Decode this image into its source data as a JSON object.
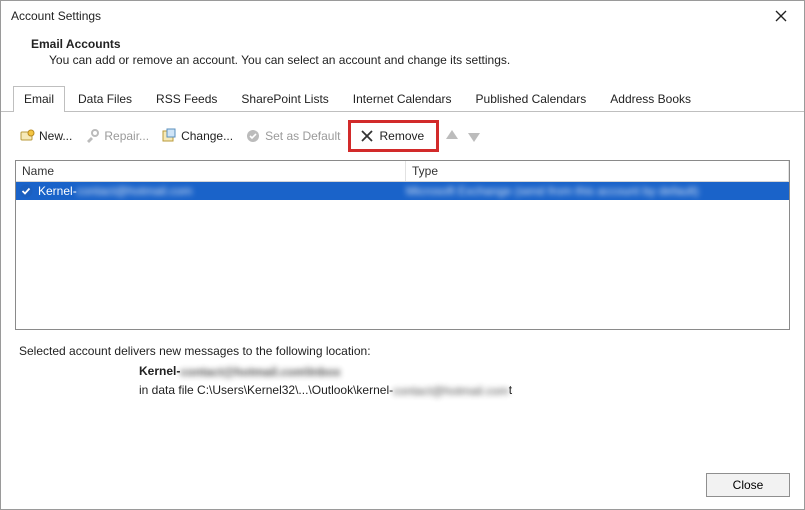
{
  "window_title": "Account Settings",
  "section": {
    "title": "Email Accounts",
    "text": "You can add or remove an account. You can select an account and change its settings."
  },
  "tabs": [
    {
      "label": "Email",
      "active": true
    },
    {
      "label": "Data Files"
    },
    {
      "label": "RSS Feeds"
    },
    {
      "label": "SharePoint Lists"
    },
    {
      "label": "Internet Calendars"
    },
    {
      "label": "Published Calendars"
    },
    {
      "label": "Address Books"
    }
  ],
  "toolbar": {
    "new_label": "New...",
    "repair_label": "Repair...",
    "change_label": "Change...",
    "set_default_label": "Set as Default",
    "remove_label": "Remove"
  },
  "columns": {
    "name": "Name",
    "type": "Type"
  },
  "accounts": [
    {
      "name_visible": "Kernel-",
      "name_hidden": "contact@hotmail.com",
      "type_hidden": "Microsoft Exchange (send from this account by default)",
      "selected": true
    }
  ],
  "below": {
    "heading": "Selected account delivers new messages to the following location:",
    "line1_prefix": "Kernel-",
    "line1_hidden": "contact@hotmail.com\\Inbox",
    "line2_prefix": "in data file C:\\Users\\Kernel32\\...\\Outlook\\kernel-",
    "line2_hidden": "contact@hotmail.com",
    "line2_suffix": "t"
  },
  "footer": {
    "close_label": "Close"
  }
}
